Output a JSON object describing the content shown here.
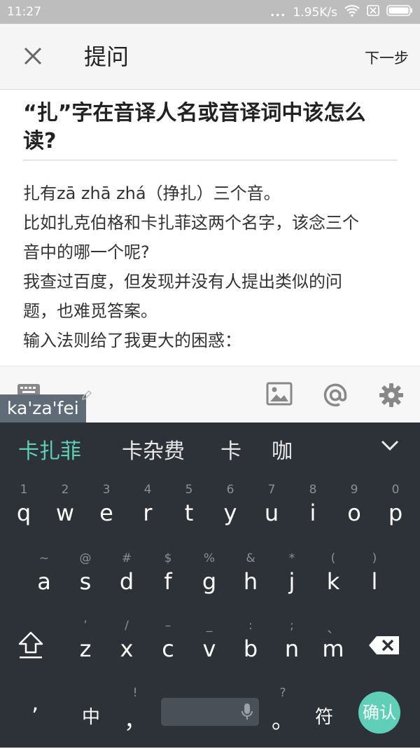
{
  "status": {
    "time": "11:27",
    "speed": "1.95K/s",
    "dots": "..."
  },
  "appbar": {
    "title": "提问",
    "next": "下一步"
  },
  "question": {
    "title": "“扎”字在音译人名或音译词中该怎么读?",
    "lines": [
      "扎有zā  zhā zhá（挣扎）三个音。",
      "比如扎克伯格和卡扎菲这两个名字，该念三个",
      "音中的哪一个呢?",
      "我查过百度，但发现并没有人提出类似的问",
      "题，也难觅答案。",
      "输入法则给了我更大的困惑："
    ]
  },
  "toolbar": {
    "icons": [
      "keyboard-icon",
      "image-icon",
      "at-icon",
      "gear-icon"
    ]
  },
  "ime": {
    "composing": "ka'za'fei",
    "candidates": [
      "卡扎菲",
      "卡杂费",
      "卡",
      "咖"
    ],
    "row1": [
      {
        "sub": "1",
        "main": "q"
      },
      {
        "sub": "2",
        "main": "w"
      },
      {
        "sub": "3",
        "main": "e"
      },
      {
        "sub": "4",
        "main": "r"
      },
      {
        "sub": "5",
        "main": "t"
      },
      {
        "sub": "6",
        "main": "y"
      },
      {
        "sub": "7",
        "main": "u"
      },
      {
        "sub": "8",
        "main": "i"
      },
      {
        "sub": "9",
        "main": "o"
      },
      {
        "sub": "0",
        "main": "p"
      }
    ],
    "row2": [
      {
        "sub": "~",
        "main": "a"
      },
      {
        "sub": "@",
        "main": "s"
      },
      {
        "sub": "#",
        "main": "d"
      },
      {
        "sub": "$",
        "main": "f"
      },
      {
        "sub": "%",
        "main": "g"
      },
      {
        "sub": "&",
        "main": "h"
      },
      {
        "sub": "*",
        "main": "j"
      },
      {
        "sub": "(",
        "main": "k"
      },
      {
        "sub": ")",
        "main": "l"
      }
    ],
    "row3": [
      {
        "sub": "’",
        "main": "z"
      },
      {
        "sub": "/",
        "main": "x"
      },
      {
        "sub": "–",
        "main": "c"
      },
      {
        "sub": "_",
        "main": "v"
      },
      {
        "sub": ":",
        "main": "b"
      },
      {
        "sub": ";",
        "main": "n"
      },
      {
        "sub": "、",
        "main": "m"
      }
    ],
    "row4": {
      "apostrophe": "’",
      "zh": "中",
      "comma_sub": "!",
      "comma": "，",
      "period_sub": "?",
      "period": "。",
      "symbol": "符",
      "confirm": "确认"
    }
  },
  "colors": {
    "accent": "#5fcfb8",
    "keyboard_bg": "#2d3238",
    "status_bg": "#bdbdbd"
  }
}
